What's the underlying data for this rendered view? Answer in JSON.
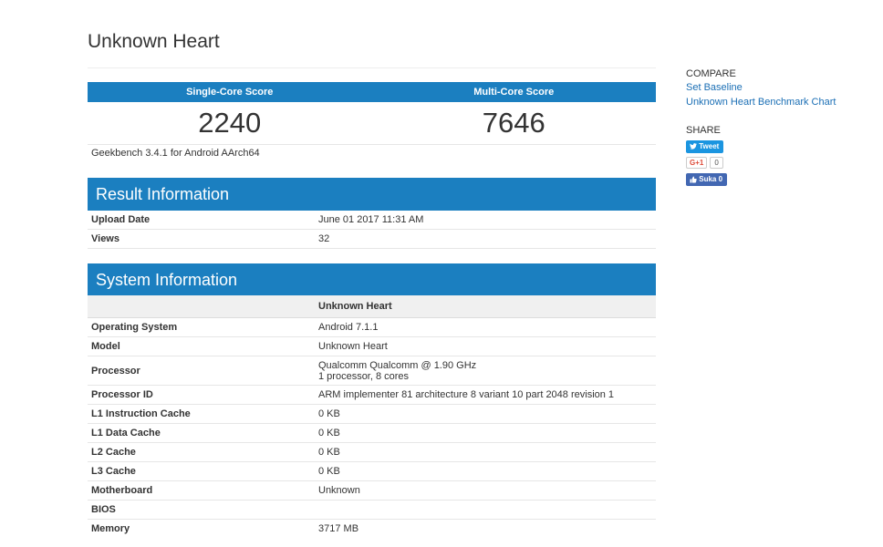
{
  "title": "Unknown Heart",
  "scores": {
    "single_label": "Single-Core Score",
    "multi_label": "Multi-Core Score",
    "single_value": "2240",
    "multi_value": "7646",
    "version": "Geekbench 3.4.1 for Android AArch64"
  },
  "result_info": {
    "heading": "Result Information",
    "rows": [
      {
        "label": "Upload Date",
        "value": "June 01 2017 11:31 AM"
      },
      {
        "label": "Views",
        "value": "32"
      }
    ]
  },
  "system_info": {
    "heading": "System Information",
    "column_header": "Unknown Heart",
    "rows": [
      {
        "label": "Operating System",
        "value": "Android 7.1.1"
      },
      {
        "label": "Model",
        "value": "Unknown Heart"
      },
      {
        "label": "Processor",
        "value": "Qualcomm Qualcomm @ 1.90 GHz",
        "value2": "1 processor, 8 cores"
      },
      {
        "label": "Processor ID",
        "value": "ARM implementer 81 architecture 8 variant 10 part 2048 revision 1"
      },
      {
        "label": "L1 Instruction Cache",
        "value": "0 KB"
      },
      {
        "label": "L1 Data Cache",
        "value": "0 KB"
      },
      {
        "label": "L2 Cache",
        "value": "0 KB"
      },
      {
        "label": "L3 Cache",
        "value": "0 KB"
      },
      {
        "label": "Motherboard",
        "value": "Unknown"
      },
      {
        "label": "BIOS",
        "value": ""
      },
      {
        "label": "Memory",
        "value": "3717 MB"
      }
    ]
  },
  "sidebar": {
    "compare_heading": "COMPARE",
    "links": [
      "Set Baseline",
      "Unknown Heart Benchmark Chart"
    ],
    "share_heading": "SHARE",
    "tweet_label": "Tweet",
    "gplus_label": "G+1",
    "gplus_count": "0",
    "fb_label": "Suka 0"
  },
  "colors": {
    "accent": "#1b7fc0",
    "link": "#1b6fb5",
    "twitter": "#1b95e0",
    "facebook": "#4267b2",
    "gplus": "#dd4b39"
  },
  "icons": [
    "twitter-bird-icon",
    "facebook-thumb-icon"
  ]
}
